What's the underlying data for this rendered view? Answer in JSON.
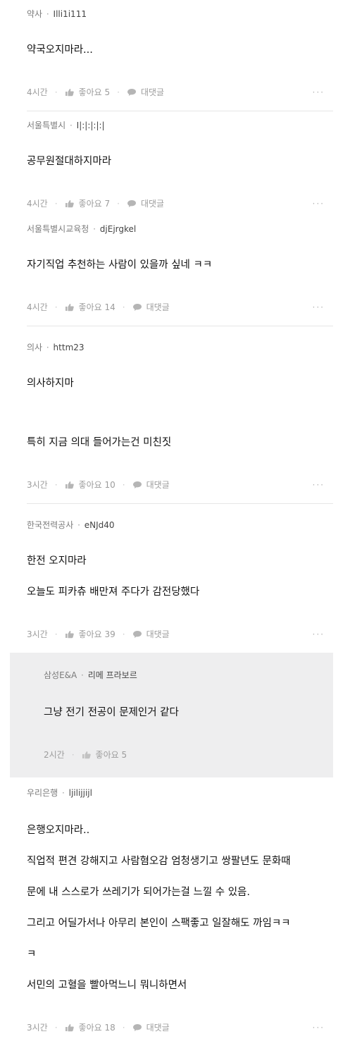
{
  "posts": [
    {
      "company": "약사",
      "nick": "Illi1i111",
      "lines": [
        "약국오지마라..."
      ],
      "time": "4시간",
      "like": "좋아요 5",
      "comment": "대댓글",
      "more": "···"
    },
    {
      "company": "서울특별시",
      "nick": "I|:|:|:|:|",
      "lines": [
        "공무원절대하지마라"
      ],
      "time": "4시간",
      "like": "좋아요 7",
      "comment": "대댓글",
      "more": "···"
    },
    {
      "company": "서울특별시교육청",
      "nick": "djEjrgkel",
      "lines": [
        "자기직업 추천하는 사람이 있을까 싶네 ㅋㅋ"
      ],
      "time": "4시간",
      "like": "좋아요 14",
      "comment": "대댓글",
      "more": "···"
    },
    {
      "company": "의사",
      "nick": "httm23",
      "lines": [
        "의사하지마",
        "",
        "특히 지금 의대 들어가는건 미친짓"
      ],
      "time": "3시간",
      "like": "좋아요 10",
      "comment": "대댓글",
      "more": "···"
    },
    {
      "company": "한국전력공사",
      "nick": "eNJd40",
      "lines": [
        "한전 오지마라",
        "오늘도 피카츄 배만져 주다가 감전당했다"
      ],
      "time": "3시간",
      "like": "좋아요 39",
      "comment": "대댓글",
      "more": "···"
    }
  ],
  "reply": {
    "company": "삼성E&A",
    "nick": "리메 프라보르",
    "lines": [
      "그냥 전기 전공이 문제인거 같다"
    ],
    "time": "2시간",
    "like": "좋아요 5"
  },
  "last_post": {
    "company": "우리은행",
    "nick": "ljilijjijl",
    "lines": [
      "은행오지마라..",
      "직업적 편견 강해지고 사람혐오감 엄청생기고 쌍팔년도 문화때",
      "문에 내 스스로가 쓰레기가 되어가는걸 느낄 수 있음.",
      "그리고 어딜가서나 아무리 본인이 스팩좋고 일잘해도 까임ㅋㅋ",
      "ㅋ",
      "서민의 고혈을 빨아먹느니 뭐니하면서"
    ],
    "time": "3시간",
    "like": "좋아요 18",
    "comment": "대댓글",
    "more": "···"
  },
  "icons": {
    "like": "thumbs-up-icon",
    "comment": "speech-bubble-icon",
    "more": "more-dots-icon"
  },
  "colors": {
    "meta": "#7b7b7b",
    "action": "#9c9c9c",
    "reply_bg": "#eeeeef"
  }
}
